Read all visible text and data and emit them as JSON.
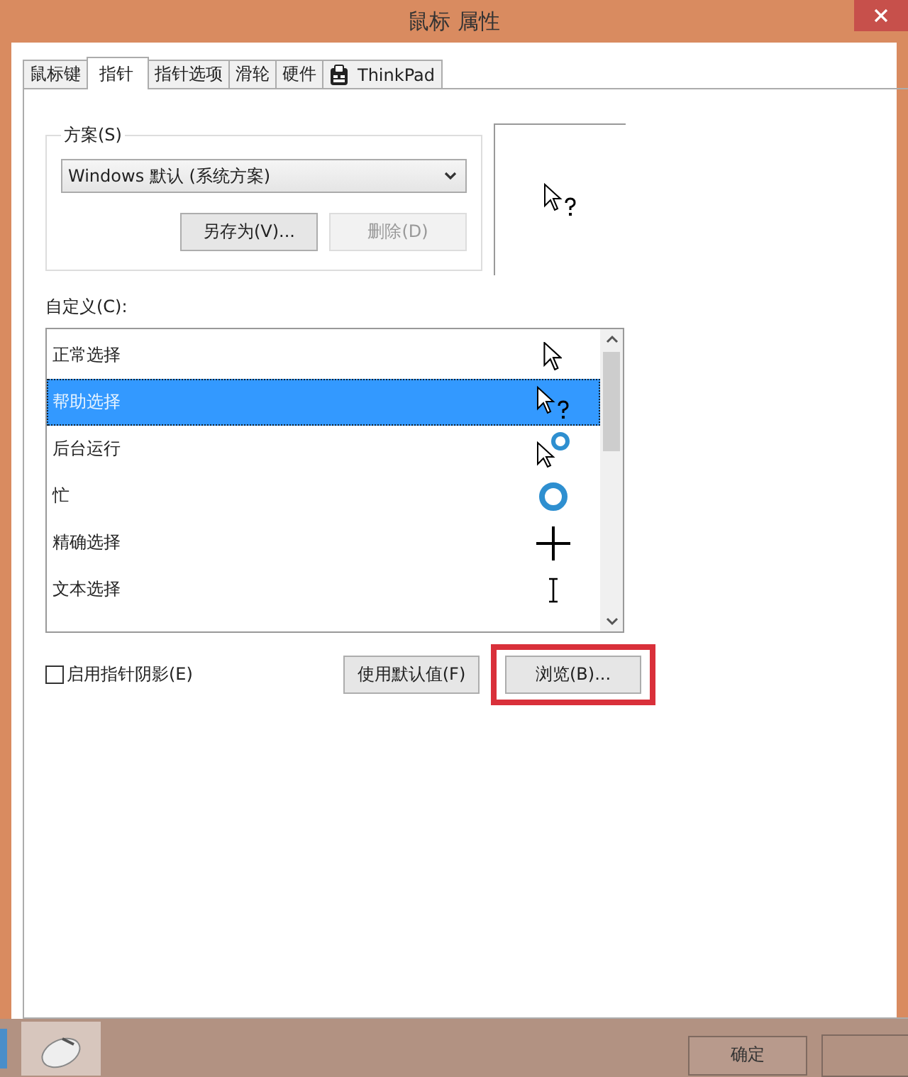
{
  "window": {
    "title": "鼠标 属性"
  },
  "tabs": [
    {
      "label": "鼠标键",
      "selected": false,
      "kind": "text"
    },
    {
      "label": "指针",
      "selected": true,
      "kind": "text"
    },
    {
      "label": "指针选项",
      "selected": false,
      "kind": "text"
    },
    {
      "label": "滑轮",
      "selected": false,
      "kind": "text"
    },
    {
      "label": "硬件",
      "selected": false,
      "kind": "text"
    },
    {
      "label": "ThinkPad",
      "selected": false,
      "kind": "icon"
    }
  ],
  "scheme": {
    "legend": "方案(S)",
    "value": "Windows 默认 (系统方案)",
    "buttons": [
      {
        "label": "另存为(V)...",
        "disabled": false
      },
      {
        "label": "删除(D)",
        "disabled": true
      }
    ]
  },
  "customize": {
    "label": "自定义(C):",
    "rows": [
      {
        "label": "正常选择",
        "selected": false,
        "kind": "arrow"
      },
      {
        "label": "帮助选择",
        "selected": true,
        "kind": "help"
      },
      {
        "label": "后台运行",
        "selected": false,
        "kind": "working"
      },
      {
        "label": "忙",
        "selected": false,
        "kind": "busy"
      },
      {
        "label": "精确选择",
        "selected": false,
        "kind": "cross"
      },
      {
        "label": "文本选择",
        "selected": false,
        "kind": "text"
      }
    ]
  },
  "shadow": {
    "label": "启用指针阴影(E)",
    "checked": false
  },
  "buttons": [
    {
      "label": "使用默认值(F)",
      "highlighted": false
    },
    {
      "label": "浏览(B)...",
      "highlighted": true
    }
  ],
  "footer": {
    "ok": "确定"
  }
}
